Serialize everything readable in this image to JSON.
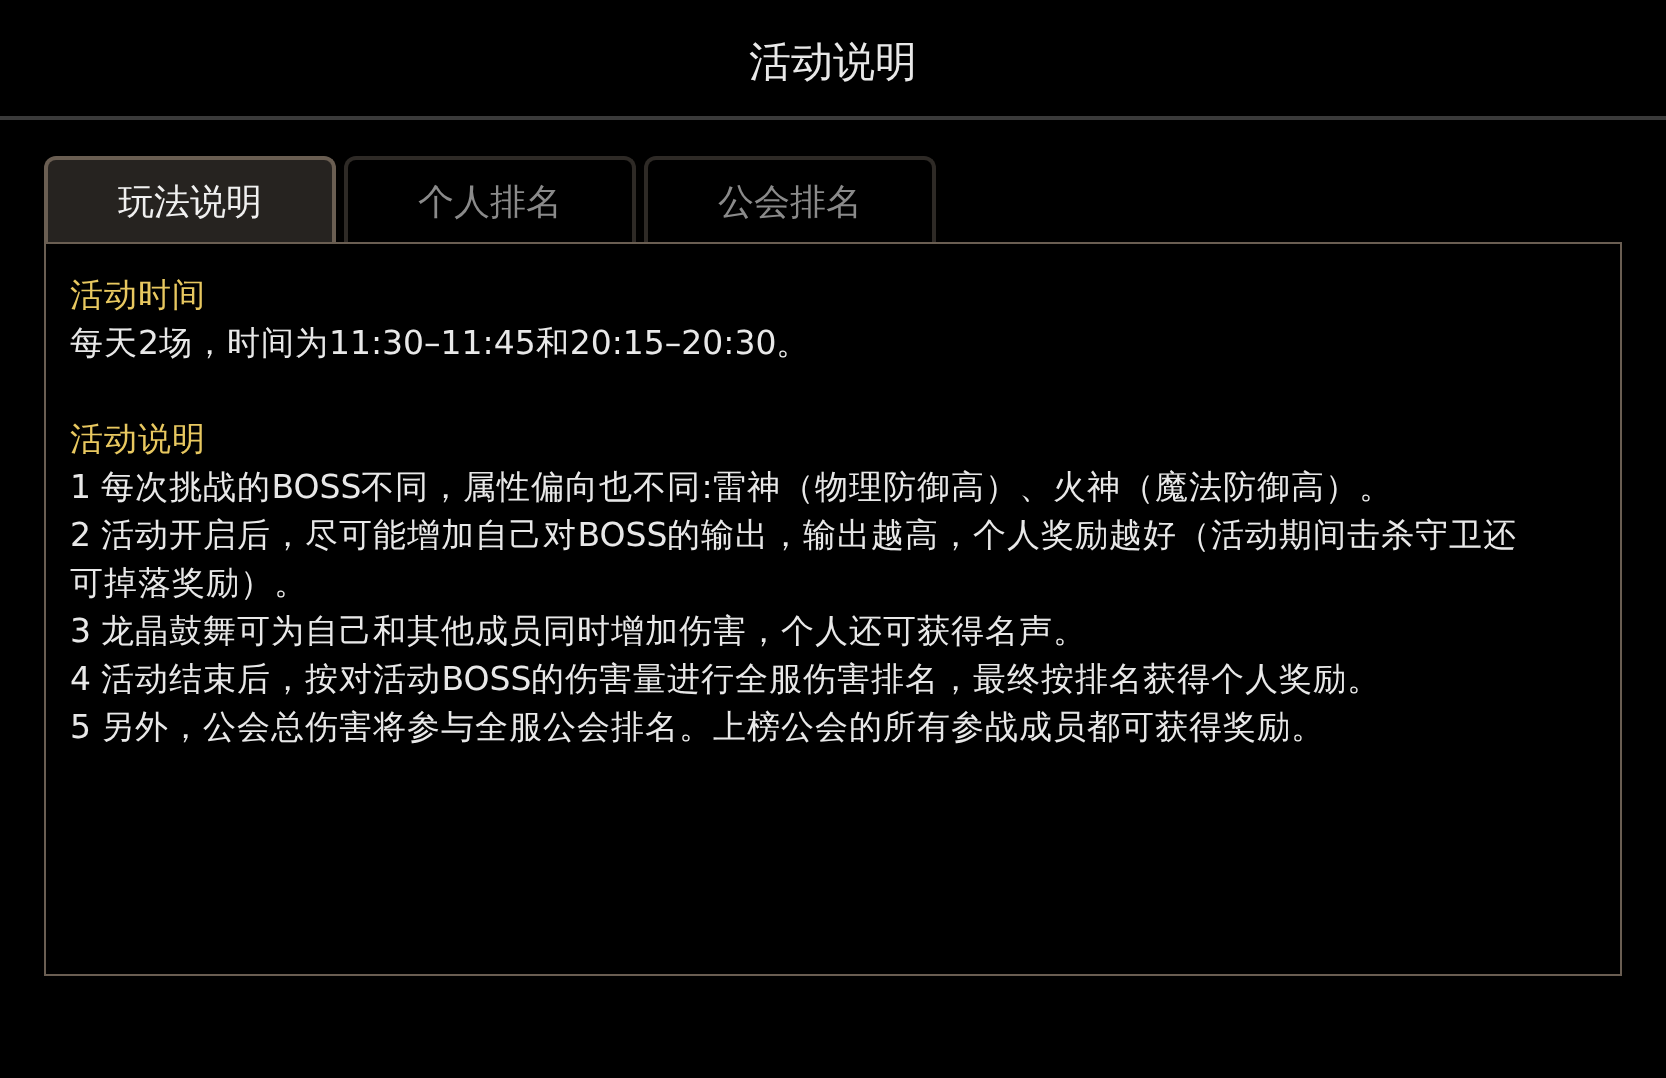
{
  "window": {
    "title": "活动说明"
  },
  "tabs": [
    {
      "label": "玩法说明",
      "selected": true
    },
    {
      "label": "个人排名",
      "selected": false
    },
    {
      "label": "公会排名",
      "selected": false
    }
  ],
  "sections": [
    {
      "heading": "活动时间",
      "paragraphs": [
        "每天2场，时间为11:30–11:45和20:15–20:30。"
      ]
    },
    {
      "heading": "活动说明",
      "paragraphs": [
        "1 每次挑战的BOSS不同，属性偏向也不同:雷神（物理防御高）、火神（魔法防御高）。",
        "2 活动开启后，尽可能增加自己对BOSS的输出，输出越高，个人奖励越好（活动期间击杀守卫还可掉落奖励）。",
        "3 龙晶鼓舞可为自己和其他成员同时增加伤害，个人还可获得名声。",
        "4 活动结束后，按对活动BOSS的伤害量进行全服伤害排名，最终按排名获得个人奖励。",
        "5 另外，公会总伤害将参与全服公会排名。上榜公会的所有参战成员都可获得奖励。"
      ]
    }
  ]
}
